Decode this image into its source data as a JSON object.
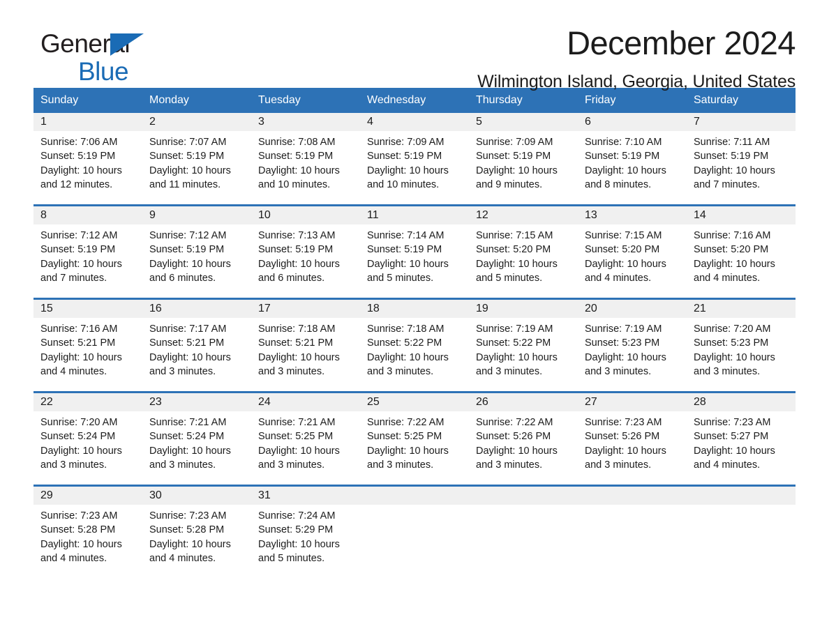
{
  "brand": {
    "name_part1": "General",
    "name_part2": "Blue",
    "logo_icon": "triangle-icon",
    "accent_color": "#1a6bb5"
  },
  "header": {
    "month_title": "December 2024",
    "location": "Wilmington Island, Georgia, United States"
  },
  "colors": {
    "header_blue": "#2d72b6",
    "daynum_gray": "#f0f0f0",
    "text": "#1c1c1c"
  },
  "calendar": {
    "weekdays": [
      "Sunday",
      "Monday",
      "Tuesday",
      "Wednesday",
      "Thursday",
      "Friday",
      "Saturday"
    ],
    "labels": {
      "sunrise": "Sunrise:",
      "sunset": "Sunset:",
      "daylight": "Daylight:"
    },
    "weeks": [
      [
        {
          "day": "1",
          "sunrise": "Sunrise: 7:06 AM",
          "sunset": "Sunset: 5:19 PM",
          "daylight_line1": "Daylight: 10 hours",
          "daylight_line2": "and 12 minutes."
        },
        {
          "day": "2",
          "sunrise": "Sunrise: 7:07 AM",
          "sunset": "Sunset: 5:19 PM",
          "daylight_line1": "Daylight: 10 hours",
          "daylight_line2": "and 11 minutes."
        },
        {
          "day": "3",
          "sunrise": "Sunrise: 7:08 AM",
          "sunset": "Sunset: 5:19 PM",
          "daylight_line1": "Daylight: 10 hours",
          "daylight_line2": "and 10 minutes."
        },
        {
          "day": "4",
          "sunrise": "Sunrise: 7:09 AM",
          "sunset": "Sunset: 5:19 PM",
          "daylight_line1": "Daylight: 10 hours",
          "daylight_line2": "and 10 minutes."
        },
        {
          "day": "5",
          "sunrise": "Sunrise: 7:09 AM",
          "sunset": "Sunset: 5:19 PM",
          "daylight_line1": "Daylight: 10 hours",
          "daylight_line2": "and 9 minutes."
        },
        {
          "day": "6",
          "sunrise": "Sunrise: 7:10 AM",
          "sunset": "Sunset: 5:19 PM",
          "daylight_line1": "Daylight: 10 hours",
          "daylight_line2": "and 8 minutes."
        },
        {
          "day": "7",
          "sunrise": "Sunrise: 7:11 AM",
          "sunset": "Sunset: 5:19 PM",
          "daylight_line1": "Daylight: 10 hours",
          "daylight_line2": "and 7 minutes."
        }
      ],
      [
        {
          "day": "8",
          "sunrise": "Sunrise: 7:12 AM",
          "sunset": "Sunset: 5:19 PM",
          "daylight_line1": "Daylight: 10 hours",
          "daylight_line2": "and 7 minutes."
        },
        {
          "day": "9",
          "sunrise": "Sunrise: 7:12 AM",
          "sunset": "Sunset: 5:19 PM",
          "daylight_line1": "Daylight: 10 hours",
          "daylight_line2": "and 6 minutes."
        },
        {
          "day": "10",
          "sunrise": "Sunrise: 7:13 AM",
          "sunset": "Sunset: 5:19 PM",
          "daylight_line1": "Daylight: 10 hours",
          "daylight_line2": "and 6 minutes."
        },
        {
          "day": "11",
          "sunrise": "Sunrise: 7:14 AM",
          "sunset": "Sunset: 5:19 PM",
          "daylight_line1": "Daylight: 10 hours",
          "daylight_line2": "and 5 minutes."
        },
        {
          "day": "12",
          "sunrise": "Sunrise: 7:15 AM",
          "sunset": "Sunset: 5:20 PM",
          "daylight_line1": "Daylight: 10 hours",
          "daylight_line2": "and 5 minutes."
        },
        {
          "day": "13",
          "sunrise": "Sunrise: 7:15 AM",
          "sunset": "Sunset: 5:20 PM",
          "daylight_line1": "Daylight: 10 hours",
          "daylight_line2": "and 4 minutes."
        },
        {
          "day": "14",
          "sunrise": "Sunrise: 7:16 AM",
          "sunset": "Sunset: 5:20 PM",
          "daylight_line1": "Daylight: 10 hours",
          "daylight_line2": "and 4 minutes."
        }
      ],
      [
        {
          "day": "15",
          "sunrise": "Sunrise: 7:16 AM",
          "sunset": "Sunset: 5:21 PM",
          "daylight_line1": "Daylight: 10 hours",
          "daylight_line2": "and 4 minutes."
        },
        {
          "day": "16",
          "sunrise": "Sunrise: 7:17 AM",
          "sunset": "Sunset: 5:21 PM",
          "daylight_line1": "Daylight: 10 hours",
          "daylight_line2": "and 3 minutes."
        },
        {
          "day": "17",
          "sunrise": "Sunrise: 7:18 AM",
          "sunset": "Sunset: 5:21 PM",
          "daylight_line1": "Daylight: 10 hours",
          "daylight_line2": "and 3 minutes."
        },
        {
          "day": "18",
          "sunrise": "Sunrise: 7:18 AM",
          "sunset": "Sunset: 5:22 PM",
          "daylight_line1": "Daylight: 10 hours",
          "daylight_line2": "and 3 minutes."
        },
        {
          "day": "19",
          "sunrise": "Sunrise: 7:19 AM",
          "sunset": "Sunset: 5:22 PM",
          "daylight_line1": "Daylight: 10 hours",
          "daylight_line2": "and 3 minutes."
        },
        {
          "day": "20",
          "sunrise": "Sunrise: 7:19 AM",
          "sunset": "Sunset: 5:23 PM",
          "daylight_line1": "Daylight: 10 hours",
          "daylight_line2": "and 3 minutes."
        },
        {
          "day": "21",
          "sunrise": "Sunrise: 7:20 AM",
          "sunset": "Sunset: 5:23 PM",
          "daylight_line1": "Daylight: 10 hours",
          "daylight_line2": "and 3 minutes."
        }
      ],
      [
        {
          "day": "22",
          "sunrise": "Sunrise: 7:20 AM",
          "sunset": "Sunset: 5:24 PM",
          "daylight_line1": "Daylight: 10 hours",
          "daylight_line2": "and 3 minutes."
        },
        {
          "day": "23",
          "sunrise": "Sunrise: 7:21 AM",
          "sunset": "Sunset: 5:24 PM",
          "daylight_line1": "Daylight: 10 hours",
          "daylight_line2": "and 3 minutes."
        },
        {
          "day": "24",
          "sunrise": "Sunrise: 7:21 AM",
          "sunset": "Sunset: 5:25 PM",
          "daylight_line1": "Daylight: 10 hours",
          "daylight_line2": "and 3 minutes."
        },
        {
          "day": "25",
          "sunrise": "Sunrise: 7:22 AM",
          "sunset": "Sunset: 5:25 PM",
          "daylight_line1": "Daylight: 10 hours",
          "daylight_line2": "and 3 minutes."
        },
        {
          "day": "26",
          "sunrise": "Sunrise: 7:22 AM",
          "sunset": "Sunset: 5:26 PM",
          "daylight_line1": "Daylight: 10 hours",
          "daylight_line2": "and 3 minutes."
        },
        {
          "day": "27",
          "sunrise": "Sunrise: 7:23 AM",
          "sunset": "Sunset: 5:26 PM",
          "daylight_line1": "Daylight: 10 hours",
          "daylight_line2": "and 3 minutes."
        },
        {
          "day": "28",
          "sunrise": "Sunrise: 7:23 AM",
          "sunset": "Sunset: 5:27 PM",
          "daylight_line1": "Daylight: 10 hours",
          "daylight_line2": "and 4 minutes."
        }
      ],
      [
        {
          "day": "29",
          "sunrise": "Sunrise: 7:23 AM",
          "sunset": "Sunset: 5:28 PM",
          "daylight_line1": "Daylight: 10 hours",
          "daylight_line2": "and 4 minutes."
        },
        {
          "day": "30",
          "sunrise": "Sunrise: 7:23 AM",
          "sunset": "Sunset: 5:28 PM",
          "daylight_line1": "Daylight: 10 hours",
          "daylight_line2": "and 4 minutes."
        },
        {
          "day": "31",
          "sunrise": "Sunrise: 7:24 AM",
          "sunset": "Sunset: 5:29 PM",
          "daylight_line1": "Daylight: 10 hours",
          "daylight_line2": "and 5 minutes."
        },
        {
          "day": "",
          "sunrise": "",
          "sunset": "",
          "daylight_line1": "",
          "daylight_line2": "",
          "empty": true
        },
        {
          "day": "",
          "sunrise": "",
          "sunset": "",
          "daylight_line1": "",
          "daylight_line2": "",
          "empty": true
        },
        {
          "day": "",
          "sunrise": "",
          "sunset": "",
          "daylight_line1": "",
          "daylight_line2": "",
          "empty": true
        },
        {
          "day": "",
          "sunrise": "",
          "sunset": "",
          "daylight_line1": "",
          "daylight_line2": "",
          "empty": true
        }
      ]
    ]
  }
}
